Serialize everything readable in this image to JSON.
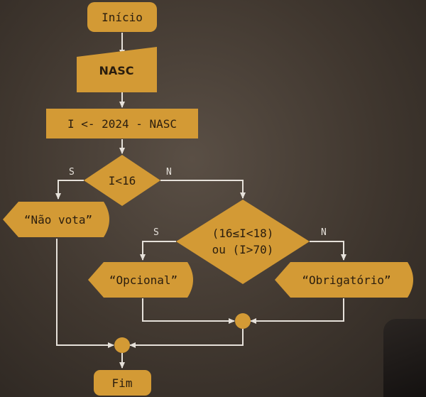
{
  "flowchart": {
    "start": "Início",
    "input": "NASC",
    "process": "I <- 2024 - NASC",
    "decision1": "I<16",
    "decision1_yes": "S",
    "decision1_no": "N",
    "output_nao_vota": "“Não vota”",
    "decision2_line1": "(16≤I<18)",
    "decision2_line2": "ou (I>70)",
    "decision2_yes": "S",
    "decision2_no": "N",
    "output_opcional": "“Opcional”",
    "output_obrigatorio": "“Obrigatório”",
    "end": "Fim"
  },
  "colors": {
    "shape_fill": "#d39a35",
    "connector": "#e6e1da",
    "background": "#40372f"
  }
}
